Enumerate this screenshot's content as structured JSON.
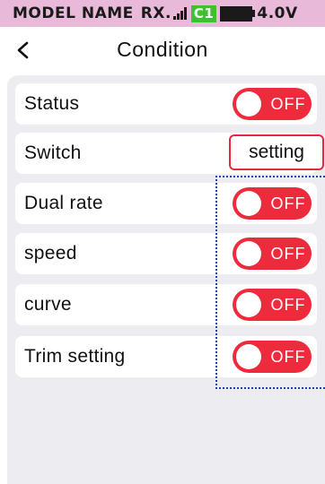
{
  "status_bar": {
    "model_name": "MODEL NAME",
    "rx_label": "RX.",
    "channel_badge": "C1",
    "voltage": "4.0V",
    "background_color": "#e9b9d9",
    "channel_badge_color": "#3dc12c"
  },
  "header": {
    "back_icon": "chevron-left-icon",
    "title": "Condition"
  },
  "rows": [
    {
      "label": "Status",
      "control": "toggle",
      "toggle_text": "OFF"
    },
    {
      "label": "Switch",
      "control": "button",
      "button_label": "setting"
    },
    {
      "label": "Dual rate",
      "control": "toggle",
      "toggle_text": "OFF"
    },
    {
      "label": "speed",
      "control": "toggle",
      "toggle_text": "OFF"
    },
    {
      "label": "curve",
      "control": "toggle",
      "toggle_text": "OFF"
    },
    {
      "label": "Trim setting",
      "control": "toggle",
      "toggle_text": "OFF"
    }
  ],
  "colors": {
    "toggle_off": "#ee2b3d",
    "panel_background": "#ededf1",
    "highlight_outline": "#2a3fa0"
  }
}
